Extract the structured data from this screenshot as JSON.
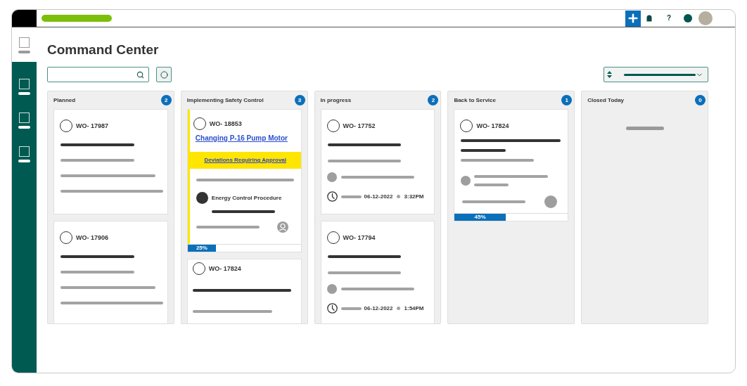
{
  "top_bar": {
    "help": "?"
  },
  "sidebar": {
    "items": [
      {
        "selected": true
      },
      {
        "selected": false
      },
      {
        "selected": false
      },
      {
        "selected": false
      }
    ]
  },
  "page": {
    "title": "Command Center"
  },
  "columns": [
    {
      "title": "Planned",
      "count": "2",
      "cards": [
        {
          "kind": "basic",
          "number": "WO- 17987"
        },
        {
          "kind": "basic",
          "number": "WO- 17906"
        }
      ]
    },
    {
      "title": "Implementing Safety Control",
      "count": "3",
      "cards": [
        {
          "kind": "safety",
          "number": "WO- 18853",
          "title": "Changing P-16 Pump Motor",
          "alert": "Deviations Requiring Approval",
          "procedure": "Energy Control Procedure",
          "progress": {
            "level": 0.25,
            "reading": "25%"
          }
        },
        {
          "kind": "summary",
          "number": "WO- 17824"
        }
      ]
    },
    {
      "title": "In progress",
      "count": "2",
      "cards": [
        {
          "kind": "scheduled",
          "number": "WO- 17752",
          "date": "06-12-2022",
          "time": "3:32PM"
        },
        {
          "kind": "scheduled",
          "number": "WO- 17794",
          "date": "06-12-2022",
          "time": "1:54PM"
        }
      ]
    },
    {
      "title": "Back to Service",
      "count": "1",
      "cards": [
        {
          "kind": "service",
          "number": "WO- 17824",
          "progress": {
            "level": 0.45,
            "reading": "45%"
          }
        }
      ]
    },
    {
      "title": "Closed Today",
      "count": "0"
    }
  ]
}
